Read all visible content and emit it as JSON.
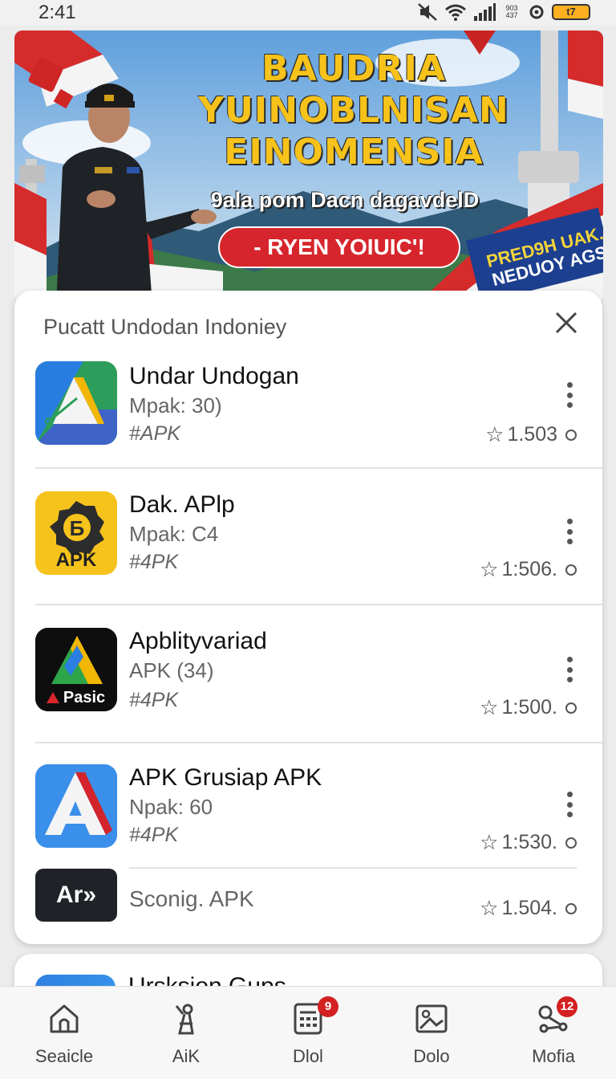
{
  "status_bar": {
    "time": "2:41",
    "network_top": "903",
    "network_bottom": "437",
    "battery": "t7",
    "icons": [
      "mute-icon",
      "wifi-icon",
      "signal-icon",
      "settings-ring-icon",
      "battery-icon"
    ]
  },
  "banner": {
    "headline_1": "BAUDRIA",
    "headline_2": "YUINOBLNISAN",
    "headline_3": "EINOMENSIA",
    "subline": "9ala pom Dacn dagavdelD",
    "cta": "- RYEN YOIUIC'!",
    "promo_1": "PRED9H UAK.",
    "promo_2": "NEDUOY AGS"
  },
  "card": {
    "title": "Pucatt Undodan Indoniey",
    "apps": [
      {
        "name": "Undar Undogan",
        "meta": "Mpak: 30)",
        "tag": "#APK",
        "rating": "1.503"
      },
      {
        "name": "Dak. APlp",
        "meta": "Mpak: C4",
        "tag": "#4PK",
        "rating": "1:506.",
        "icon_text": "APK"
      },
      {
        "name": "Apblityvariad",
        "meta": "APK (34)",
        "tag": "#4PK",
        "rating": "1:500.",
        "icon_text": "Pasic"
      },
      {
        "name": "APK Grusiap APK",
        "meta": "Npak: 60",
        "tag": "#4PK",
        "rating": "1:530."
      },
      {
        "name": "Sconig. APK",
        "rating": "1.504.",
        "icon_text": "Ar»"
      }
    ]
  },
  "card2": {
    "name": "Ursksion Gups"
  },
  "nav": [
    {
      "label": "Seaicle",
      "icon": "home-icon"
    },
    {
      "label": "AiK",
      "icon": "antenna-icon"
    },
    {
      "label": "Dlol",
      "icon": "calculator-icon",
      "badge": "9"
    },
    {
      "label": "Dolo",
      "icon": "image-icon"
    },
    {
      "label": "Mofia",
      "icon": "share-icon",
      "badge": "12"
    }
  ],
  "colors": {
    "brand_red": "#d6252c",
    "headline_yellow": "#f7c31a",
    "badge_red": "#d32020"
  }
}
